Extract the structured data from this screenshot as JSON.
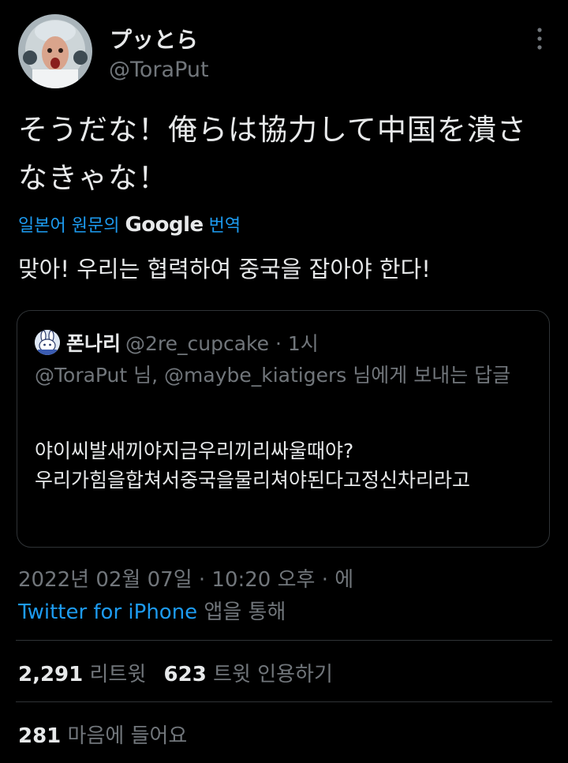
{
  "author": {
    "display_name": "プッとら",
    "handle": "@ToraPut"
  },
  "tweet": {
    "text": "そうだな！俺らは協力して中国を潰さなきゃな！",
    "translation_label": "일본어 원문의",
    "translation_brand": "Google",
    "translation_suffix": "번역",
    "translated_text": "맞아! 우리는 협력하여 중국을 잡아야 한다!"
  },
  "quoted": {
    "name": "폰나리",
    "handle": "@2re_cupcake",
    "time": " · 1시",
    "replying_to": "@ToraPut 님, @maybe_kiatigers 님에게 보내는 답글",
    "body_line1": "야이씨발새끼야지금우리끼리싸울때야?",
    "body_line2": "우리가힘을합쳐서중국을물리쳐야된다고정신차리라고"
  },
  "meta": {
    "timestamp": "2022년 02월 07일 · 10:20 오후 · 에",
    "client": "Twitter for iPhone",
    "client_suffix": " 앱을 통해"
  },
  "stats": {
    "retweets": "2,291",
    "retweets_label": "리트윗",
    "quotes": "623",
    "quotes_label": "트윗 인용하기",
    "likes": "281",
    "likes_label": "마음에 들어요"
  },
  "colors": {
    "background": "#000000",
    "text": "#e7e9ea",
    "secondary": "#71767b",
    "link": "#1d9bf0",
    "border": "#2f3336"
  },
  "icons": {
    "more": "more-vertical-icon"
  }
}
